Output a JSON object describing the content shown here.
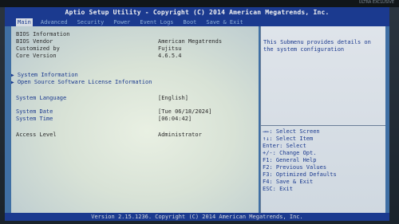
{
  "bezel_label": "ULTRA EXCLUSIVE",
  "title": "Aptio Setup Utility - Copyright (C) 2014 American Megatrends, Inc.",
  "tabs": [
    "Main",
    "Advanced",
    "Security",
    "Power",
    "Event Logs",
    "Boot",
    "Save & Exit"
  ],
  "info": {
    "bios_information": "BIOS Information",
    "bios_vendor_label": "BIOS Vendor",
    "bios_vendor_value": "American Megatrends",
    "customized_label": "Customized by",
    "customized_value": "Fujitsu",
    "core_label": "Core Version",
    "core_value": "4.6.5.4"
  },
  "menu": {
    "system_information": "System Information",
    "license_information": "Open Source Software License Information"
  },
  "settings": {
    "language_label": "System Language",
    "language_value": "[English]",
    "date_label": "System Date",
    "date_value": "[Tue 06/18/2024]",
    "time_label": "System Time",
    "time_value": "[06:04:42]",
    "access_label": "Access Level",
    "access_value": "Administrator"
  },
  "help": {
    "description": "This Submenu provides details on the system configuration"
  },
  "keys": [
    "→←: Select Screen",
    "↑↓: Select Item",
    "Enter: Select",
    "+/-: Change Opt.",
    "F1: General Help",
    "F2: Previous Values",
    "F3: Optimized Defaults",
    "F4: Save & Exit",
    "ESC: Exit"
  ],
  "footer": "Version 2.15.1236. Copyright (C) 2014 American Megatrends, Inc."
}
